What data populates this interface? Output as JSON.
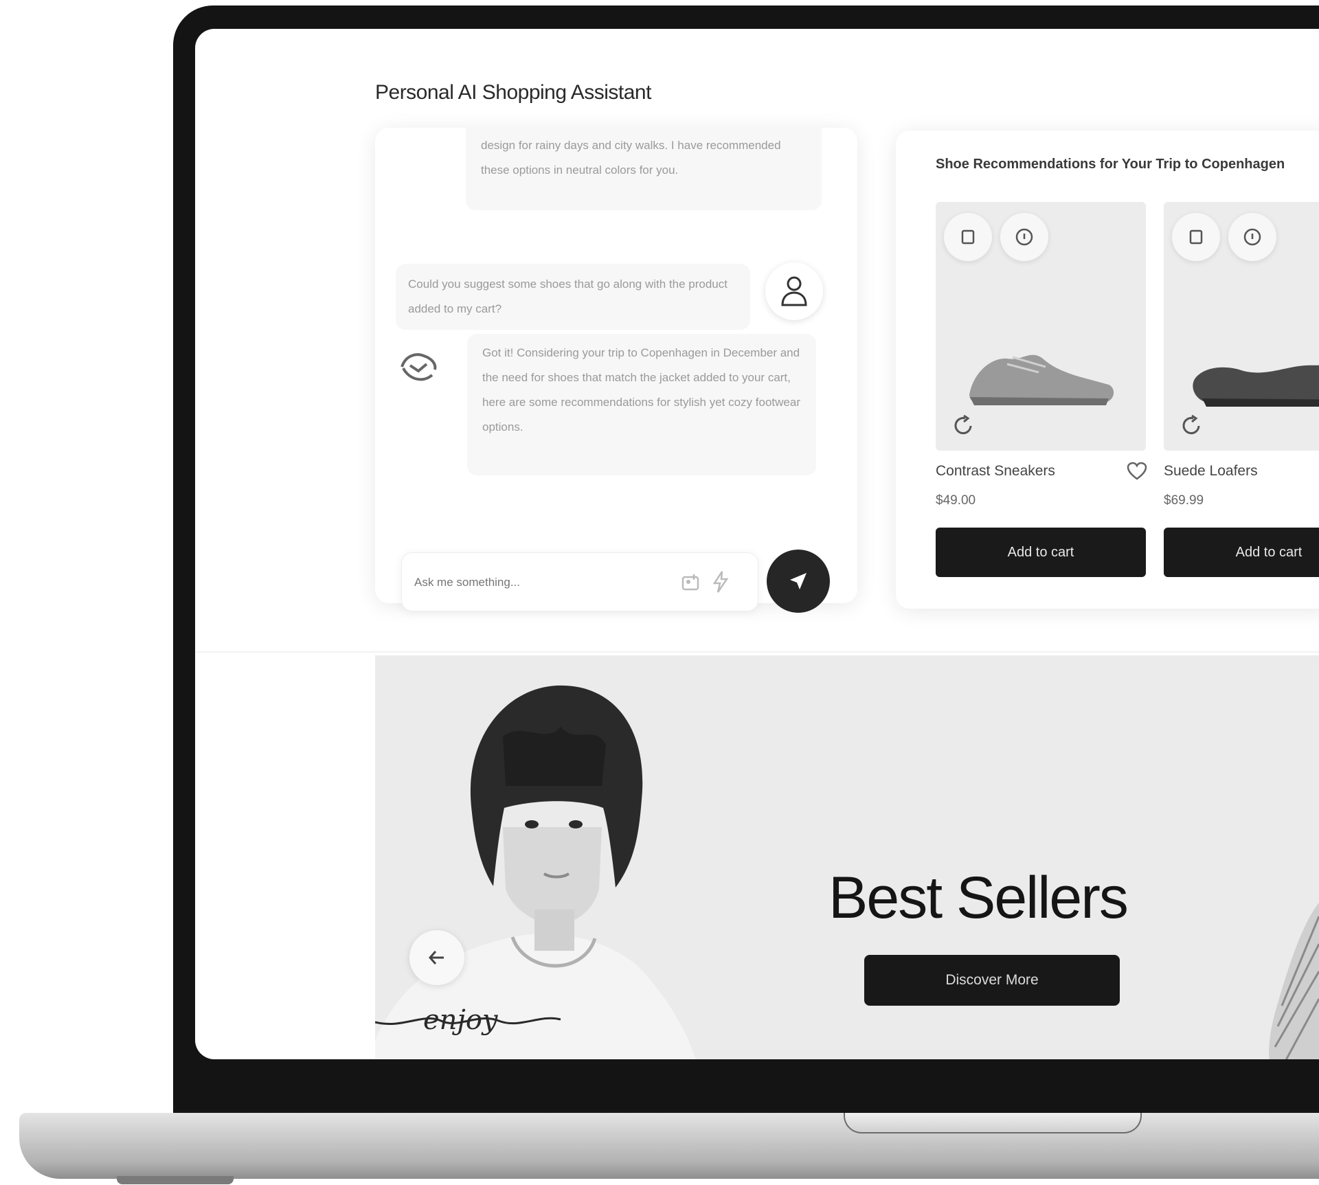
{
  "assistant": {
    "title": "Personal AI Shopping Assistant",
    "messages": [
      {
        "role": "assistant",
        "text": "design for rainy days and city walks. I have recommended these options in neutral colors for you."
      },
      {
        "role": "user",
        "text": "Could you suggest some shoes that go along with the product added to my cart?"
      },
      {
        "role": "assistant",
        "text": "Got it! Considering your trip to Copenhagen in December and the need for shoes that match the jacket added to your cart, here are some recommendations for stylish yet cozy footwear options."
      }
    ],
    "input_placeholder": "Ask me something..."
  },
  "recommendations": {
    "title": "Shoe Recommendations for Your Trip to Copenhagen",
    "products": [
      {
        "name": "Contrast Sneakers",
        "price": "$49.00",
        "cta": "Add to cart",
        "color": "#9a9a9a"
      },
      {
        "name": "Suede Loafers",
        "price": "$69.99",
        "cta": "Add to cart",
        "color": "#4a4a4a"
      }
    ]
  },
  "banner": {
    "title": "Best Sellers",
    "cta": "Discover More",
    "shirt_text": "enjoy"
  },
  "icons": {
    "user_avatar": "user-icon",
    "bot_avatar": "bot-icon",
    "send": "send-icon",
    "card_actions": [
      "bookmark-icon",
      "info-icon"
    ],
    "rotate": "rotate-icon",
    "wishlist": "heart-icon",
    "banner_prev": "arrow-left-icon"
  }
}
